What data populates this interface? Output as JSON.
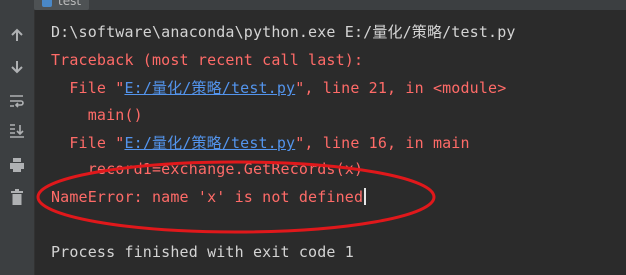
{
  "tab": {
    "label": "test"
  },
  "gutter": {
    "icons": [
      "arrow-up-icon",
      "arrow-down-icon",
      "soft-wrap-icon",
      "scroll-to-end-icon",
      "print-icon",
      "trash-icon"
    ]
  },
  "console": {
    "command": "D:\\software\\anaconda\\python.exe E:/量化/策略/test.py",
    "traceback_header": "Traceback (most recent call last):",
    "frame1": {
      "prefix": "  File \"",
      "path": "E:/量化/策略/test.py",
      "suffix": "\", line 21, in <module>"
    },
    "frame1_code": "    main()",
    "frame2": {
      "prefix": "  File \"",
      "path": "E:/量化/策略/test.py",
      "suffix": "\", line 16, in main"
    },
    "frame2_code": "    record1=exchange.GetRecords(x)",
    "error": "NameError: name 'x' is not defined",
    "exit_message": "Process finished with exit code 1"
  },
  "colors": {
    "background": "#2b2b2b",
    "error_red": "#ff6b68",
    "link_blue": "#5394ec",
    "annotation_red": "#e0181b"
  }
}
